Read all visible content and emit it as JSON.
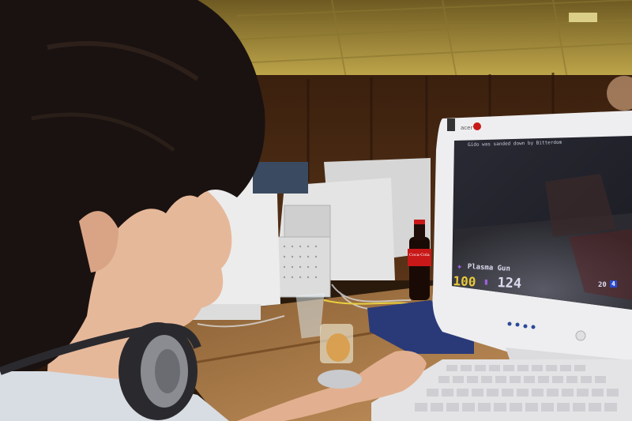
{
  "scene": {
    "description_colors": {
      "ceiling": "#b8a24a",
      "wall": "#4a2a14",
      "desk": "#b88a50",
      "monitor_shell": "#e8e8ea",
      "hair": "#1a1210",
      "skin": "#e6b89a",
      "game_floor": "#3a3a40",
      "hud_yellow": "#e8c83a",
      "hud_white": "#dcdcf0"
    }
  },
  "monitor": {
    "brand_label": "acer"
  },
  "game_hud": {
    "top_message": "Gido was sanded down by Bitterdom",
    "weapon_name": "Plasma Gun",
    "health": "100",
    "ammo": "124",
    "score": "20",
    "score_secondary": "4"
  },
  "bottle": {
    "label": "Coca-Cola"
  }
}
